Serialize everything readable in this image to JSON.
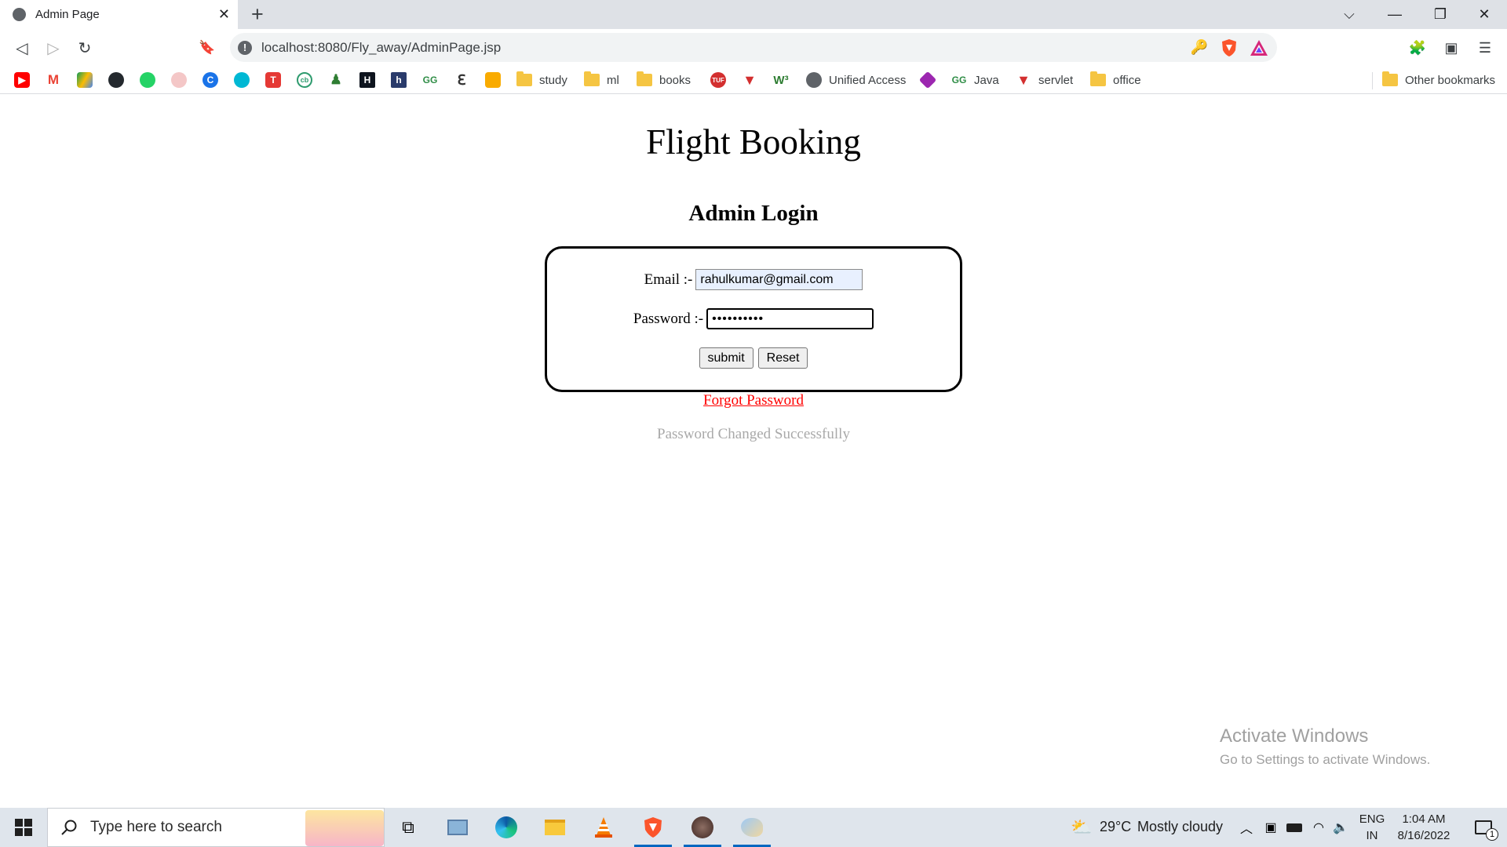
{
  "browser": {
    "tab_title": "Admin Page",
    "tab_close": "✕",
    "new_tab": "+",
    "url": "localhost:8080/Fly_away/AdminPage.jsp",
    "window_controls": {
      "tab_search": "⌵",
      "minimize": "—",
      "restore": "❐",
      "close": "✕"
    },
    "nav": {
      "back": "◁",
      "forward": "▷",
      "reload": "↻",
      "bookmark": "🔖"
    },
    "info_glyph": "!",
    "right_icons": {
      "key": "🔑",
      "extensions": "🧩",
      "wallet": "▣",
      "menu": "☰"
    }
  },
  "bookmarks": {
    "study": "study",
    "ml": "ml",
    "books": "books",
    "unified_access": "Unified Access",
    "java": "Java",
    "servlet": "servlet",
    "office": "office",
    "other": "Other bookmarks"
  },
  "page": {
    "title": "Flight Booking",
    "subtitle": "Admin Login",
    "email_label": "Email :-",
    "email_value": "rahulkumar@gmail.com",
    "password_label": "Password :-",
    "password_value": "••••••••••",
    "submit_label": "submit",
    "reset_label": "Reset",
    "forgot_link": "Forgot Password",
    "status_message": "Password Changed Successfully"
  },
  "watermark": {
    "line1": "Activate Windows",
    "line2": "Go to Settings to activate Windows."
  },
  "taskbar": {
    "search_placeholder": "Type here to search",
    "weather_temp": "29°C",
    "weather_desc": "Mostly cloudy",
    "lang_top": "ENG",
    "lang_bottom": "IN",
    "time": "1:04 AM",
    "date": "8/16/2022",
    "notification_count": "1"
  }
}
